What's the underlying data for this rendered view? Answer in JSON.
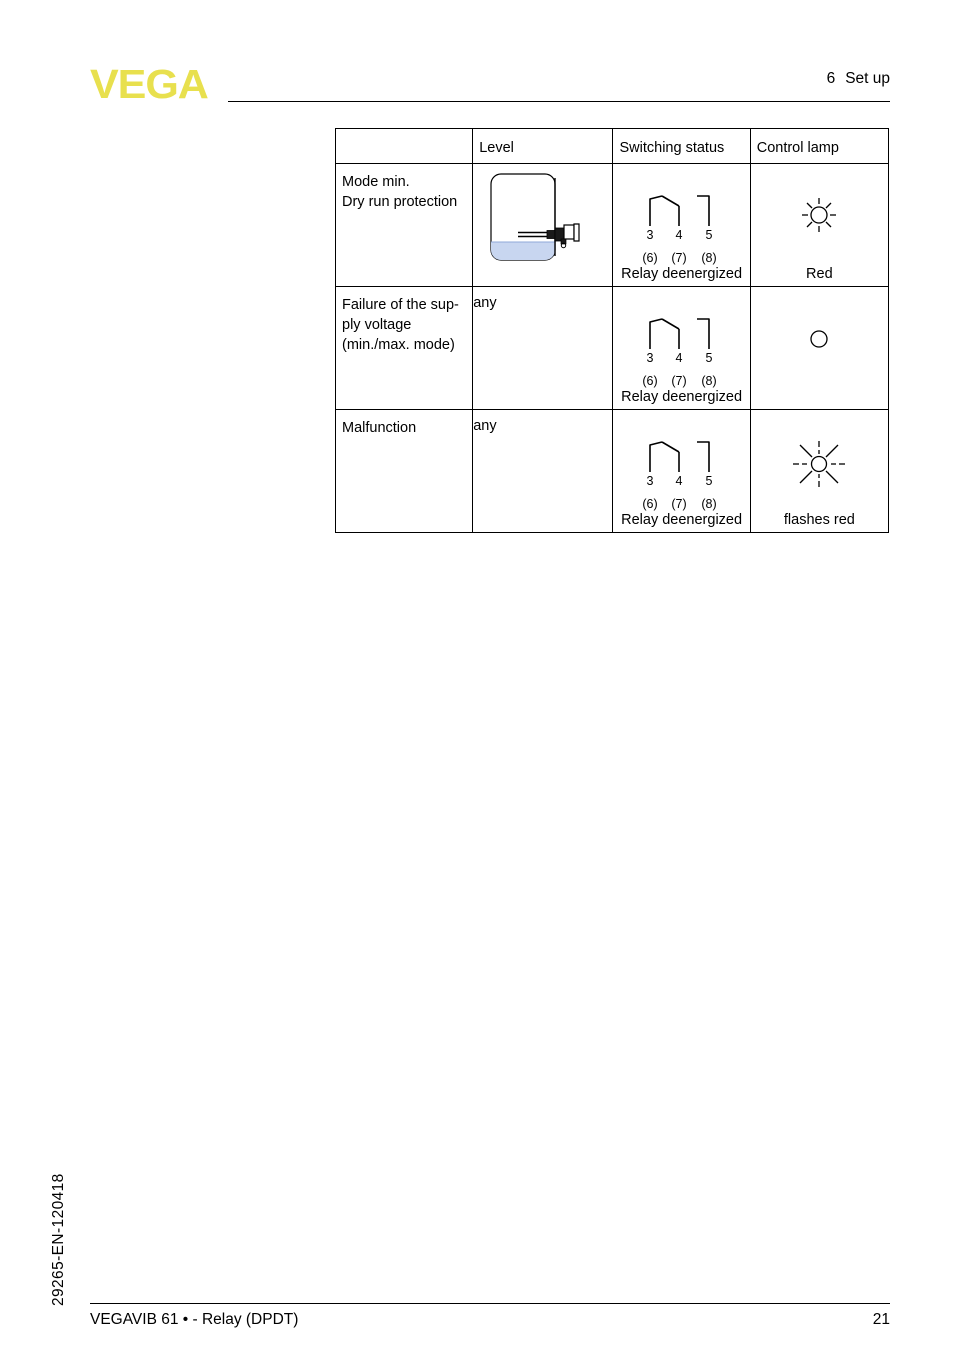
{
  "header": {
    "logo_text": "VEGA",
    "chapter_number": "6",
    "chapter_title": "Set up"
  },
  "table": {
    "columns": [
      "",
      "Level",
      "Switching status",
      "Control lamp"
    ],
    "rows": [
      {
        "condition_lines": [
          "Mode min.",
          "Dry run protection"
        ],
        "level_type": "tank-diagram",
        "level_text": "",
        "switching": {
          "terminals": [
            "3",
            "4",
            "5"
          ],
          "alt_terminals": [
            "(6)",
            "(7)",
            "(8)"
          ],
          "caption": "Relay deenergized"
        },
        "lamp": {
          "icon": "lamp-lit-icon",
          "state": "lit",
          "caption": "Red"
        }
      },
      {
        "condition_lines": [
          "Failure of the sup-",
          "ply voltage",
          "(min./max. mode)"
        ],
        "level_type": "text",
        "level_text": "any",
        "switching": {
          "terminals": [
            "3",
            "4",
            "5"
          ],
          "alt_terminals": [
            "(6)",
            "(7)",
            "(8)"
          ],
          "caption": "Relay deenergized"
        },
        "lamp": {
          "icon": "lamp-off-icon",
          "state": "off",
          "caption": ""
        }
      },
      {
        "condition_lines": [
          "Malfunction"
        ],
        "level_type": "text",
        "level_text": "any",
        "switching": {
          "terminals": [
            "3",
            "4",
            "5"
          ],
          "alt_terminals": [
            "(6)",
            "(7)",
            "(8)"
          ],
          "caption": "Relay deenergized"
        },
        "lamp": {
          "icon": "lamp-flashing-icon",
          "state": "flashing",
          "caption": "flashes red"
        }
      }
    ]
  },
  "tank_diagram": {
    "liquid_color": "#c8d6f0",
    "outline_color": "#000000",
    "description": "vessel with low liquid level and horizontally mounted vibrating level switch"
  },
  "doc_code": "29265-EN-120418",
  "footer": {
    "product": "VEGAVIB 61 • - Relay (DPDT)",
    "page_number": "21"
  },
  "colors": {
    "logo_yellow": "#e8e04e",
    "rule": "#000000",
    "liquid": "#c8d6f0"
  }
}
